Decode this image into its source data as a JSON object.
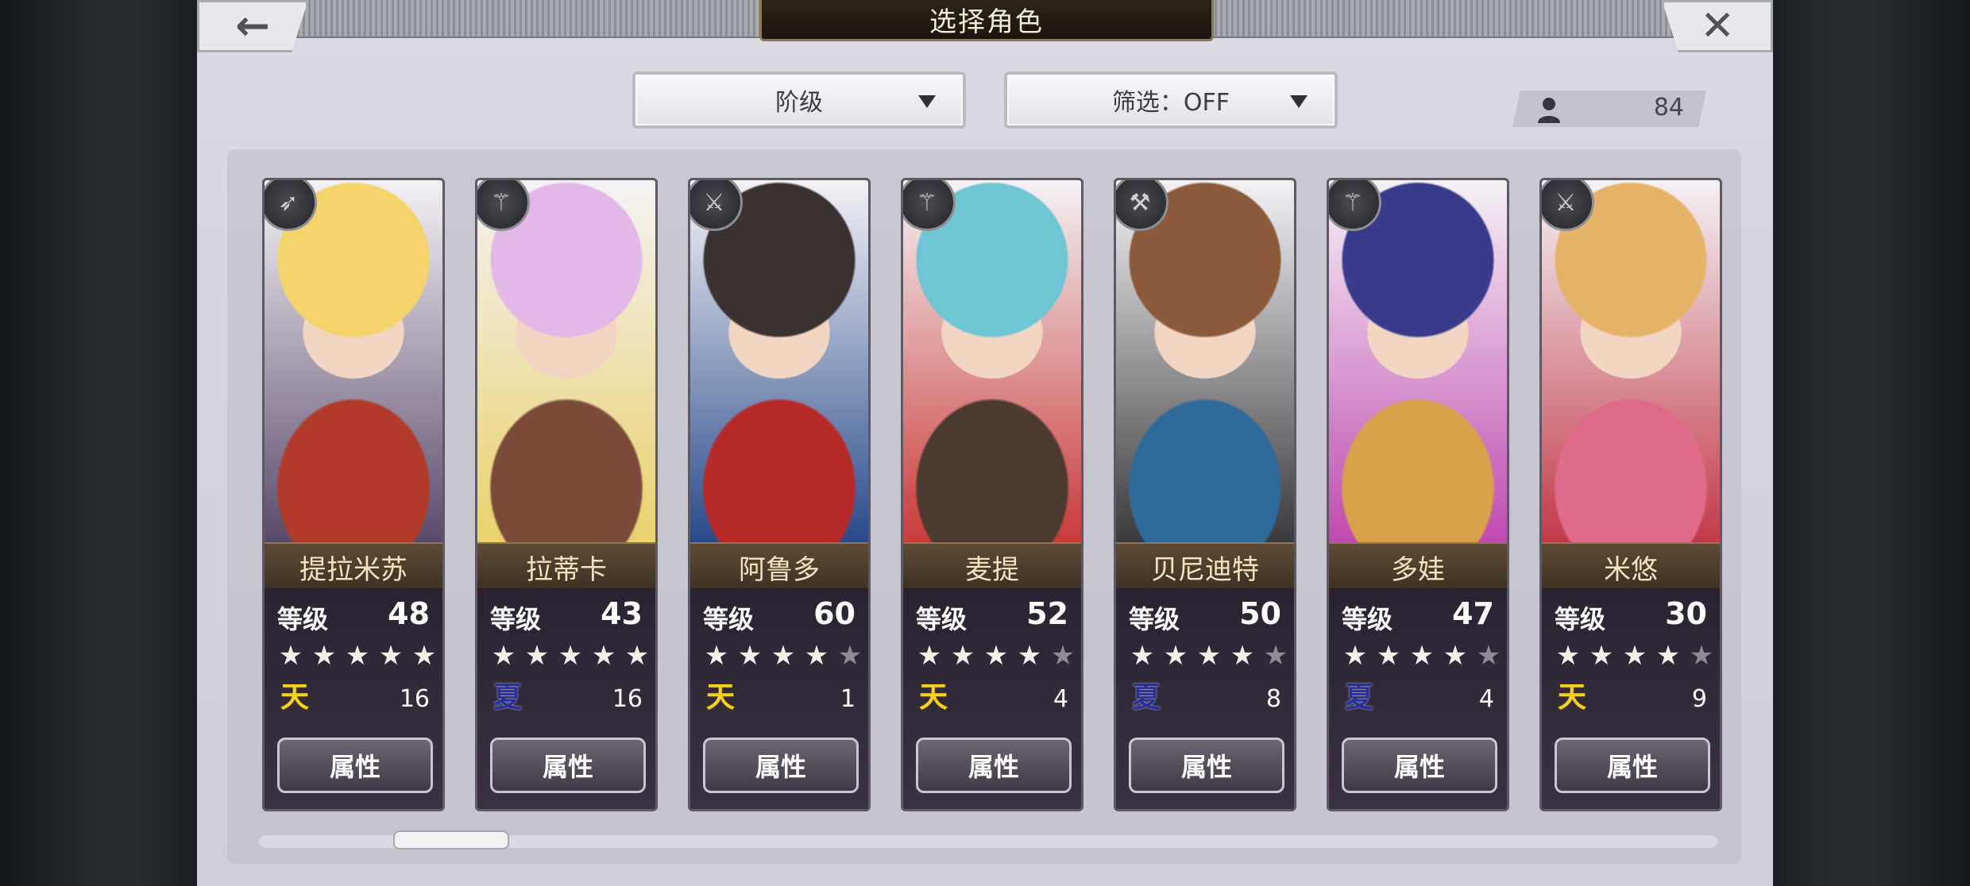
{
  "header": {
    "title": "选择角色",
    "back_icon": "←",
    "close_icon": "✕"
  },
  "filters": {
    "sort_label": "阶级",
    "filter_label": "筛选：OFF"
  },
  "roster_count": "84",
  "level_label": "等级",
  "attr_button_label": "属性",
  "characters": [
    {
      "name": "提拉米苏",
      "level": "48",
      "stars": 5,
      "tier": "天",
      "tier_count": "16",
      "weapon": "spear",
      "colors": [
        "#f4d46a",
        "#b23a2a",
        "#5a4a6a"
      ]
    },
    {
      "name": "拉蒂卡",
      "level": "43",
      "stars": 5,
      "tier": "夏",
      "tier_count": "16",
      "weapon": "staff",
      "colors": [
        "#e2b8e6",
        "#7a4a3a",
        "#e8d26a"
      ]
    },
    {
      "name": "阿鲁多",
      "level": "60",
      "stars": 4,
      "tier": "天",
      "tier_count": "1",
      "weapon": "sword",
      "colors": [
        "#3a3230",
        "#b82a28",
        "#2a4a8a"
      ]
    },
    {
      "name": "麦提",
      "level": "52",
      "stars": 4,
      "tier": "天",
      "tier_count": "4",
      "weapon": "staff",
      "colors": [
        "#6ec6d4",
        "#4a3a30",
        "#c93a3a"
      ]
    },
    {
      "name": "贝尼迪特",
      "level": "50",
      "stars": 4,
      "tier": "夏",
      "tier_count": "8",
      "weapon": "axe",
      "colors": [
        "#8a5a3a",
        "#2e6a9a",
        "#3a3a3c"
      ]
    },
    {
      "name": "多娃",
      "level": "47",
      "stars": 4,
      "tier": "夏",
      "tier_count": "4",
      "weapon": "staff",
      "colors": [
        "#3a3a8a",
        "#d8a24a",
        "#c04ab0"
      ]
    },
    {
      "name": "米悠",
      "level": "30",
      "stars": 4,
      "tier": "天",
      "tier_count": "9",
      "weapon": "sword",
      "colors": [
        "#e6b468",
        "#e06a8a",
        "#c23a4a"
      ]
    }
  ],
  "scrollbar": {
    "position": 0.1
  }
}
